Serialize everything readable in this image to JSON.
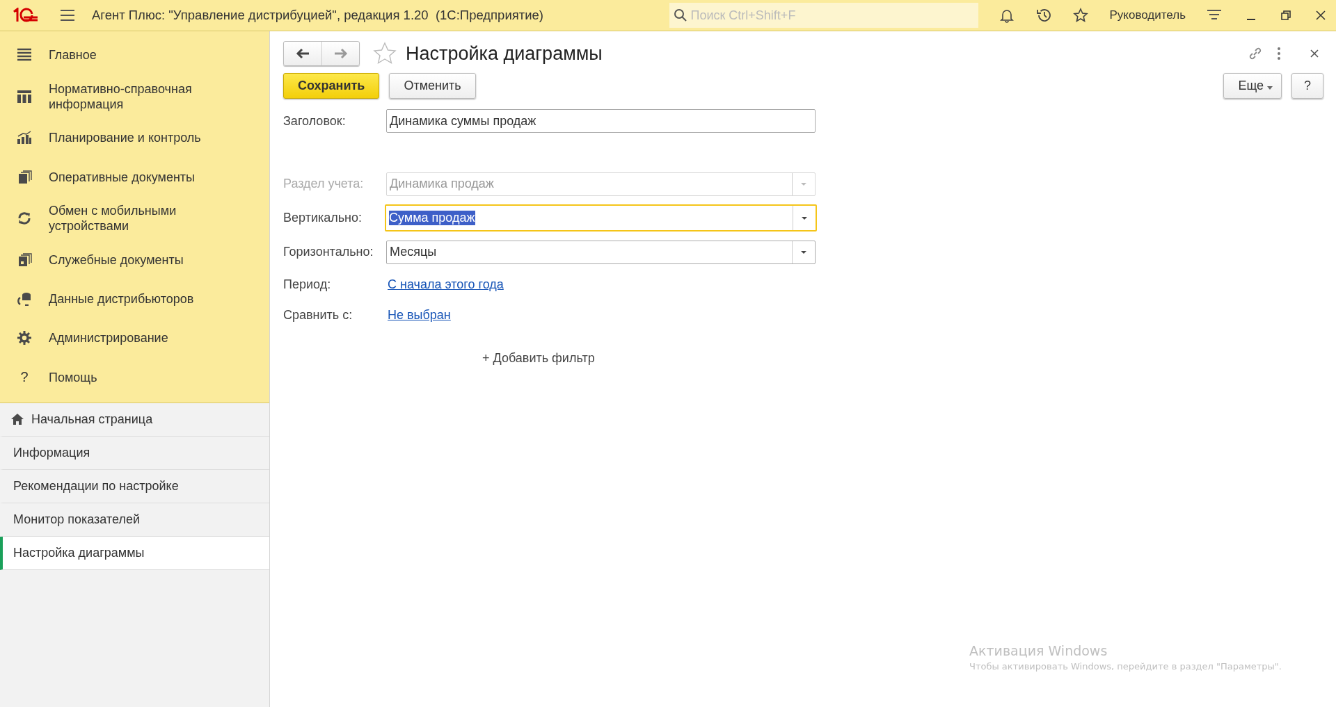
{
  "titlebar": {
    "title": "Агент Плюс: \"Управление дистрибуцией\", редакция 1.20  (1С:Предприятие)",
    "search_placeholder": "Поиск Ctrl+Shift+F",
    "user": "Руководитель"
  },
  "sections": [
    {
      "label": "Главное"
    },
    {
      "label": "Нормативно-справочная информация"
    },
    {
      "label": "Планирование и контроль"
    },
    {
      "label": "Оперативные документы"
    },
    {
      "label": "Обмен с мобильными устройствами"
    },
    {
      "label": "Служебные документы"
    },
    {
      "label": "Данные дистрибьюторов"
    },
    {
      "label": "Администрирование"
    },
    {
      "label": "Помощь",
      "icon_text": "?"
    }
  ],
  "open_pages": [
    {
      "label": "Начальная страница",
      "kind": "home",
      "selected": false
    },
    {
      "label": "Информация",
      "kind": "page",
      "selected": false
    },
    {
      "label": "Рекомендации по настройке",
      "kind": "page",
      "selected": false
    },
    {
      "label": "Монитор показателей",
      "kind": "page",
      "selected": false
    },
    {
      "label": "Настройка диаграммы",
      "kind": "page",
      "selected": true
    }
  ],
  "form": {
    "title": "Настройка диаграммы",
    "buttons": {
      "save": "Сохранить",
      "cancel": "Отменить",
      "more": "Еще",
      "help": "?"
    },
    "fields": [
      {
        "label": "Заголовок:",
        "kind": "text",
        "value": "Динамика суммы продаж",
        "disabled": false,
        "focused": false
      },
      {
        "label": "Раздел учета:",
        "kind": "select",
        "value": "Динамика продаж",
        "disabled": true,
        "focused": false
      },
      {
        "label": "Вертикально:",
        "kind": "select",
        "value": "Сумма продаж",
        "disabled": false,
        "focused": true
      },
      {
        "label": "Горизонтально:",
        "kind": "select",
        "value": "Месяцы",
        "disabled": false,
        "focused": false
      },
      {
        "label": "Период:",
        "kind": "link",
        "value": "С начала этого года"
      },
      {
        "label": "Сравнить с:",
        "kind": "link",
        "value": "Не выбран"
      }
    ],
    "add_filter": "+ Добавить фильтр"
  },
  "activation": {
    "title": "Активация Windows",
    "text": "Чтобы активировать Windows, перейдите в раздел \"Параметры\"."
  }
}
